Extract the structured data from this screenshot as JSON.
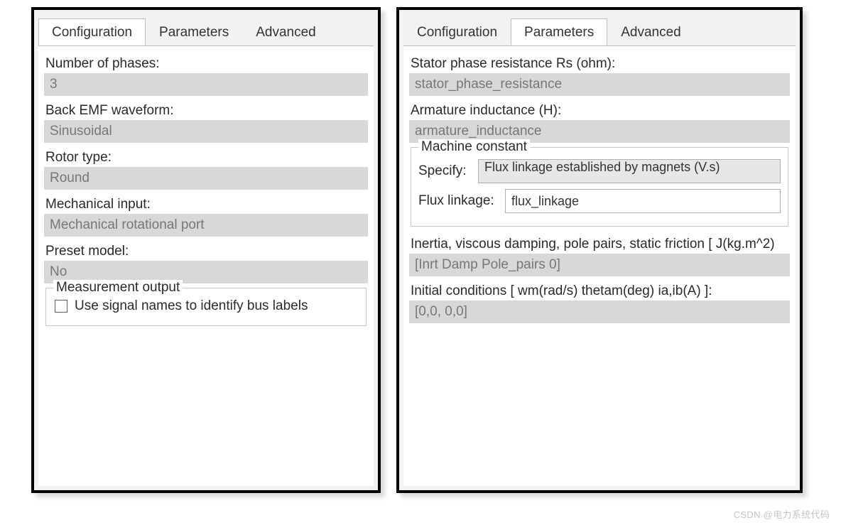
{
  "left": {
    "tabs": [
      "Configuration",
      "Parameters",
      "Advanced"
    ],
    "active_tab": 0,
    "fields": {
      "num_phases_label": "Number of phases:",
      "num_phases_value": "3",
      "back_emf_label": "Back EMF waveform:",
      "back_emf_value": "Sinusoidal",
      "rotor_type_label": "Rotor type:",
      "rotor_type_value": "Round",
      "mech_input_label": "Mechanical input:",
      "mech_input_value": "Mechanical rotational port",
      "preset_model_label": "Preset model:",
      "preset_model_value": "No"
    },
    "measurement": {
      "legend": "Measurement output",
      "checkbox_label": "Use signal names to identify bus labels",
      "checkbox_checked": false
    }
  },
  "right": {
    "tabs": [
      "Configuration",
      "Parameters",
      "Advanced"
    ],
    "active_tab": 1,
    "fields": {
      "rs_label": "Stator phase resistance Rs (ohm):",
      "rs_value": "stator_phase_resistance",
      "la_label": "Armature inductance (H):",
      "la_value": "armature_inductance"
    },
    "machine_constant": {
      "legend": "Machine constant",
      "specify_label": "Specify:",
      "specify_value": "Flux linkage established by magnets (V.s)",
      "flux_label": "Flux linkage:",
      "flux_value": "flux_linkage"
    },
    "inertia_label": "Inertia, viscous damping, pole pairs, static friction [ J(kg.m^2)",
    "inertia_value": "[Inrt Damp Pole_pairs 0]",
    "init_label": "Initial conditions  [ wm(rad/s)  thetam(deg)  ia,ib(A) ]:",
    "init_value": "[0,0, 0,0]"
  },
  "watermark": "CSDN @电力系统代码"
}
